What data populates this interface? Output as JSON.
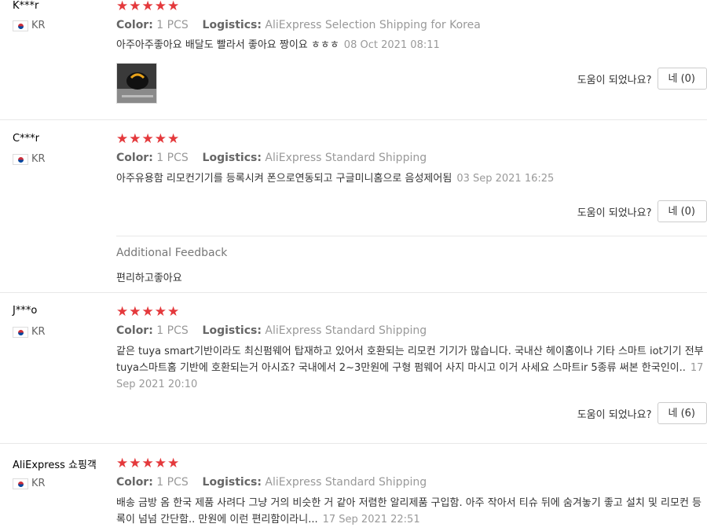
{
  "reviews": [
    {
      "user": "K***r",
      "country": "KR",
      "stars": "★★★★★",
      "color_label": "Color:",
      "color_value": "1 PCS",
      "logistics_label": "Logistics:",
      "logistics_value": "AliExpress Selection Shipping for Korea",
      "text": "아주아주좋아요 배달도 빨라서 좋아요 짱이요 ㅎㅎㅎ",
      "date": "08 Oct 2021 08:11",
      "helpful": "도움이 되었나요?",
      "yes": "네 (0)"
    },
    {
      "user": "C***r",
      "country": "KR",
      "stars": "★★★★★",
      "color_label": "Color:",
      "color_value": "1 PCS",
      "logistics_label": "Logistics:",
      "logistics_value": "AliExpress Standard Shipping",
      "text": "아주유용함 리모컨기기를 등록시켜 폰으로연동되고 구글미니홈으로 음성제어됨",
      "date": "03 Sep 2021 16:25",
      "helpful": "도움이 되었나요?",
      "yes": "네 (0)",
      "additional_label": "Additional Feedback",
      "additional_text": "편리하고좋아요"
    },
    {
      "user": "J***o",
      "country": "KR",
      "stars": "★★★★★",
      "color_label": "Color:",
      "color_value": "1 PCS",
      "logistics_label": "Logistics:",
      "logistics_value": "AliExpress Standard Shipping",
      "text": "같은 tuya smart기반이라도 최신펌웨어 탑재하고 있어서 호환되는 리모컨 기기가 많습니다. 국내산 헤이홈이나 기타 스마트 iot기기 전부 tuya스마트홈 기반에 호환되는거 아시죠? 국내에서 2~3만원에 구형 펌웨어 사지 마시고 이거 사세요 스마트ir 5종류 써본 한국인이..",
      "date": "17 Sep 2021 20:10",
      "helpful": "도움이 되었나요?",
      "yes": "네 (6)"
    },
    {
      "user": "AliExpress 쇼핑객",
      "country": "KR",
      "stars": "★★★★★",
      "color_label": "Color:",
      "color_value": "1 PCS",
      "logistics_label": "Logistics:",
      "logistics_value": "AliExpress Standard Shipping",
      "text": "배송 금방 옴 한국 제품 사려다 그냥 거의 비슷한 거 같아 저렴한 알리제품 구입함. 아주 작아서 티슈 뒤에 숨겨놓기 좋고 설치 및 리모컨 등록이 넘넘 간단함.. 만원에 이런 편리함이라니...",
      "date": "17 Sep 2021 22:51"
    }
  ],
  "colors": {
    "star": "#e4393c",
    "muted": "#999999",
    "divider": "#e8e8e8"
  }
}
